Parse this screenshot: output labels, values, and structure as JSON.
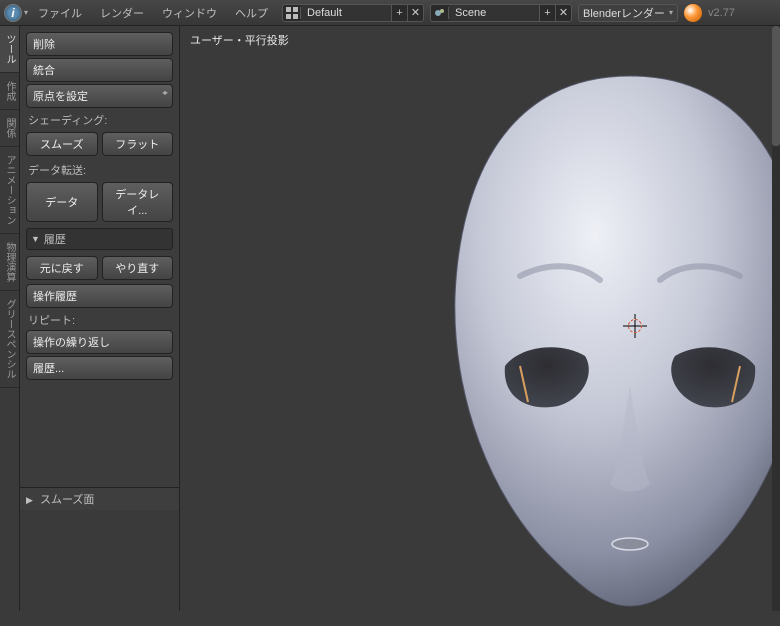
{
  "header": {
    "menus": [
      "ファイル",
      "レンダー",
      "ウィンドウ",
      "ヘルプ"
    ],
    "layout": "Default",
    "scene": "Scene",
    "renderer": "Blenderレンダー",
    "version": "v2.77"
  },
  "tabs": [
    "ツール",
    "作成",
    "関係",
    "アニメーション",
    "物理演算",
    "グリースペンシル"
  ],
  "tool_panel": {
    "delete": "削除",
    "join": "統合",
    "set_origin": "原点を設定",
    "shading_label": "シェーディング:",
    "smooth": "スムーズ",
    "flat": "フラット",
    "data_transfer_label": "データ転送:",
    "data": "データ",
    "data_layout": "データレイ...",
    "history_head": "履歴",
    "undo": "元に戻す",
    "redo": "やり直す",
    "op_history": "操作履歴",
    "repeat_label": "リピート:",
    "repeat_op": "操作の繰り返し",
    "history_btn": "履歴...",
    "bottom_panel": "スムーズ面"
  },
  "viewport": {
    "label": "ユーザー・平行投影"
  }
}
